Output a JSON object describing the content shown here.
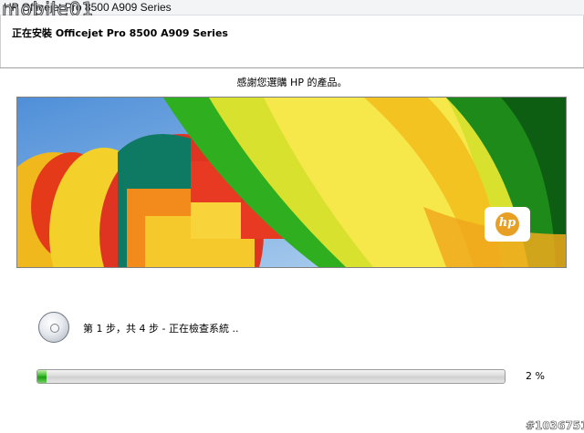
{
  "window": {
    "title": "HP Officejet Pro 8500 A909 Series",
    "watermark": "mobile01"
  },
  "header": {
    "title": "正在安裝 Officejet Pro 8500 A909 Series"
  },
  "main": {
    "thanks_text": "感謝您選購 HP 的產品。",
    "banner_logo_text": "hp",
    "step_text": "第 1 步，共 4 步 - 正在檢查系統 ..",
    "step_icon": "cd-disc-icon",
    "progress_percent": 2,
    "progress_label": "2 %"
  },
  "footer": {
    "image_id": "#1036751"
  },
  "colors": {
    "progress_fill": "#2bb21b",
    "logo_orange": "#e8a024",
    "sky": "#6fa7e0"
  }
}
